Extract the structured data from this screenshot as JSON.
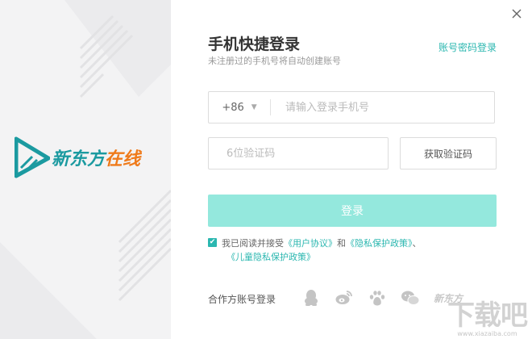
{
  "logo": {
    "brand_part1": "新东方",
    "brand_part2": "在线"
  },
  "header": {
    "title": "手机快捷登录",
    "subtitle": "未注册过的手机号将自动创建账号",
    "switch_link": "账号密码登录"
  },
  "phone": {
    "country_code": "+86",
    "placeholder": "请输入登录手机号"
  },
  "code": {
    "placeholder": "6位验证码",
    "get_code_label": "获取验证码"
  },
  "login_button": "登录",
  "agreement": {
    "prefix": "我已阅读并接受",
    "user_agreement": "《用户协议》",
    "and": "和",
    "privacy_policy": "《隐私保护政策》",
    "separator": "、",
    "children_privacy": "《儿童隐私保护政策》",
    "checked": true
  },
  "partner": {
    "label": "合作方账号登录",
    "icons": [
      "qq-icon",
      "weibo-icon",
      "baidu-icon",
      "wechat-icon"
    ],
    "xdf_label": "新东方"
  },
  "watermark": {
    "main": "下载吧",
    "sub": "www.xiazaiba.com"
  },
  "colors": {
    "accent": "#2bb7b0",
    "login_button": "#94e8dd",
    "brand_teal": "#1b9aa0",
    "brand_orange": "#ef7a1a"
  }
}
